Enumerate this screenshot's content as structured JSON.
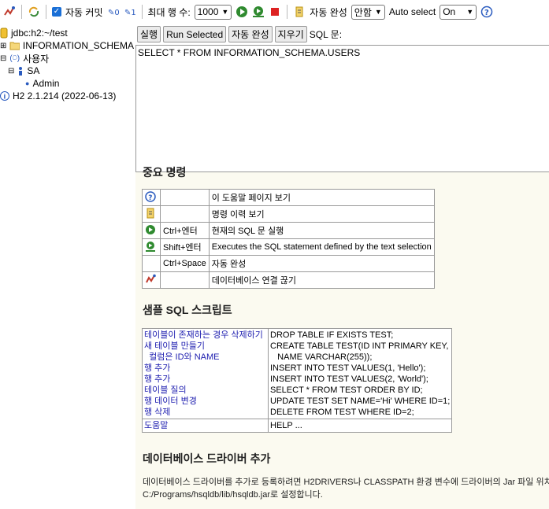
{
  "toolbar": {
    "auto_commit_label": "자동 커밋",
    "max_rows_label": "최대 행 수:",
    "max_rows_value": "1000",
    "auto_complete_label": "자동 완성",
    "auto_complete_value": "안함",
    "auto_select_label": "Auto select",
    "auto_select_value": "On"
  },
  "tree": {
    "connection": "jdbc:h2:~/test",
    "schema": "INFORMATION_SCHEMA",
    "users_label": "사용자",
    "user_sa": "SA",
    "user_role": "Admin",
    "version": "H2 2.1.214 (2022-06-13)"
  },
  "buttons": {
    "run": "실행",
    "run_selected": "Run Selected",
    "auto_complete": "자동 완성",
    "clear": "지우기",
    "sql_label": "SQL 문:"
  },
  "editor": {
    "sql": "SELECT * FROM INFORMATION_SCHEMA.USERS"
  },
  "help": {
    "important_title": "중요 명령",
    "commands": [
      {
        "icon": "help-icon",
        "key": "",
        "desc": "이 도움말 페이지 보기"
      },
      {
        "icon": "history-icon",
        "key": "",
        "desc": "명령 이력 보기"
      },
      {
        "icon": "run-icon",
        "key": "Ctrl+엔터",
        "desc": "현재의 SQL 문 실행"
      },
      {
        "icon": "run-selected-icon",
        "key": "Shift+엔터",
        "desc": "Executes the SQL statement defined by the text selection"
      },
      {
        "icon": "",
        "key": "Ctrl+Space",
        "desc": "자동 완성"
      },
      {
        "icon": "disconnect-icon",
        "key": "",
        "desc": "데이터베이스 연결 끊기"
      }
    ],
    "sample_title": "샘플 SQL 스크립트",
    "sample_links": [
      "테이블이 존재하는 경우 삭제하기",
      "새 테이블 만들기",
      "  컬럼은 ID와 NAME",
      "행 추가",
      "행 추가",
      "테이블 질의",
      "행 데이터 변경",
      "행 삭제"
    ],
    "sample_sql": [
      "DROP TABLE IF EXISTS TEST;",
      "CREATE TABLE TEST(ID INT PRIMARY KEY,",
      "   NAME VARCHAR(255));",
      "INSERT INTO TEST VALUES(1, 'Hello');",
      "INSERT INTO TEST VALUES(2, 'World');",
      "SELECT * FROM TEST ORDER BY ID;",
      "UPDATE TEST SET NAME='Hi' WHERE ID=1;",
      "DELETE FROM TEST WHERE ID=2;"
    ],
    "help_link": "도움말",
    "help_sql": "HELP ...",
    "driver_title": "데이터베이스 드라이버 추가",
    "driver_text_1": "데이터베이스 드라이버를 추가로 등록하려면 H2DRIVERS나 CLASSPATH 환경 변수에 드라이버의 Jar 파일 위치",
    "driver_text_2": "C:/Programs/hsqldb/lib/hsqldb.jar로 설정합니다."
  }
}
